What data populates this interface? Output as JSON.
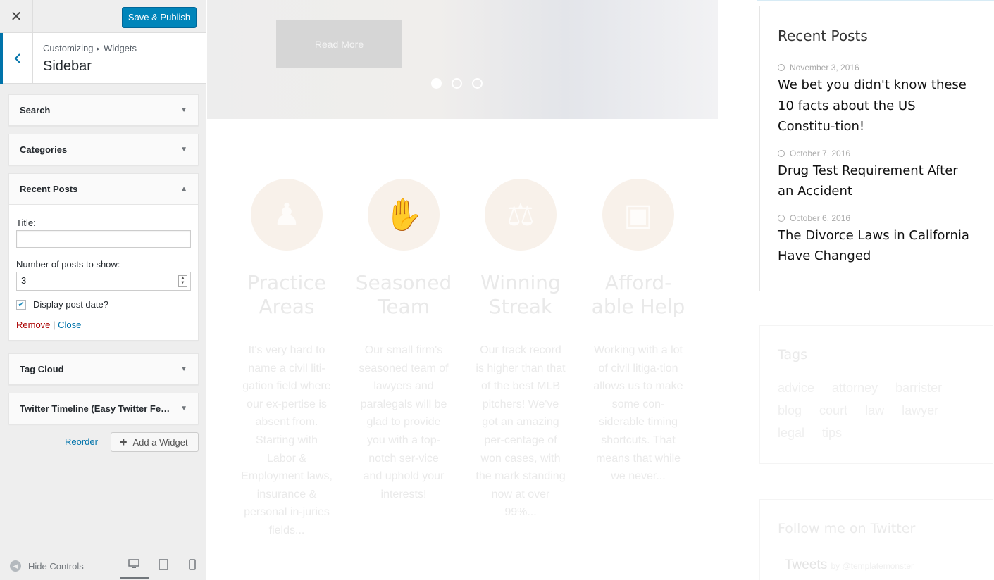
{
  "header": {
    "close_symbol": "✕",
    "publish_label": "Save & Publish"
  },
  "panel": {
    "breadcrumb_parent": "Customizing",
    "breadcrumb_sep": "▸",
    "breadcrumb_child": "Widgets",
    "title": "Sidebar"
  },
  "widgets": [
    {
      "title": "Search",
      "arrow": "▼"
    },
    {
      "title": "Categories",
      "arrow": "▼"
    },
    {
      "title": "Recent Posts",
      "arrow": "▲"
    },
    {
      "title": "Tag Cloud",
      "arrow": "▼"
    },
    {
      "title": "Twitter Timeline (Easy Twitter Feed Widget)",
      "arrow": "▼"
    }
  ],
  "recent_form": {
    "title_label": "Title:",
    "title_value": "",
    "count_label": "Number of posts to show:",
    "count_value": "3",
    "display_date_label": "Display post date?",
    "display_date_checked": "✔",
    "remove_label": "Remove",
    "divider": "|",
    "close_label": "Close"
  },
  "controls": {
    "reorder_label": "Reorder",
    "add_widget_label": "Add a Widget",
    "add_symbol": "+"
  },
  "footer": {
    "hide_controls_label": "Hide Controls"
  },
  "preview": {
    "read_more": "Read More",
    "features": [
      {
        "icon": "person-tie-icon",
        "icon_glyph": "♟",
        "title": "Practice Areas",
        "text": "It's very hard to name a civil liti-gation field where our ex-pertise is absent from. Starting with Labor & Employment laws, insurance & personal in-juries fields..."
      },
      {
        "icon": "handshake-icon",
        "icon_glyph": "✋",
        "title": "Seasoned Team",
        "text": "Our small firm's seasoned team of lawyers and paralegals will be glad to provide you with a top-notch ser-vice and uphold your interests!"
      },
      {
        "icon": "scales-icon",
        "icon_glyph": "⚖",
        "title": "Winning Streak",
        "text": "Our track record is higher than that of the best MLB pitchers! We've got an amazing per-centage of won cases, with the mark standing now at over 99%..."
      },
      {
        "icon": "wallet-icon",
        "icon_glyph": "▣",
        "title": "Afford-able Help",
        "text": "Working with a lot of civil litiga-tion allows us to make some con-siderable timing shortcuts. That means that while we never..."
      }
    ],
    "recent_posts": {
      "title": "Recent Posts",
      "items": [
        {
          "date": "November 3, 2016",
          "title": "We bet you didn't know these 10 facts about the US Constitu-tion!"
        },
        {
          "date": "October 7, 2016",
          "title": "Drug Test Requirement After an Accident"
        },
        {
          "date": "October 6, 2016",
          "title": "The Divorce Laws in California Have Changed"
        }
      ]
    },
    "tags": {
      "title": "Tags",
      "items": [
        "advice",
        "attorney",
        "barrister",
        "blog",
        "court",
        "law",
        "lawyer",
        "legal",
        "tips"
      ]
    },
    "twitter": {
      "title": "Follow me on Twitter",
      "tweets_label": "Tweets",
      "handle": "by @templatemonster"
    }
  },
  "colors": {
    "accent": "#0085ba",
    "link": "#0073aa",
    "danger": "#aa0000"
  }
}
